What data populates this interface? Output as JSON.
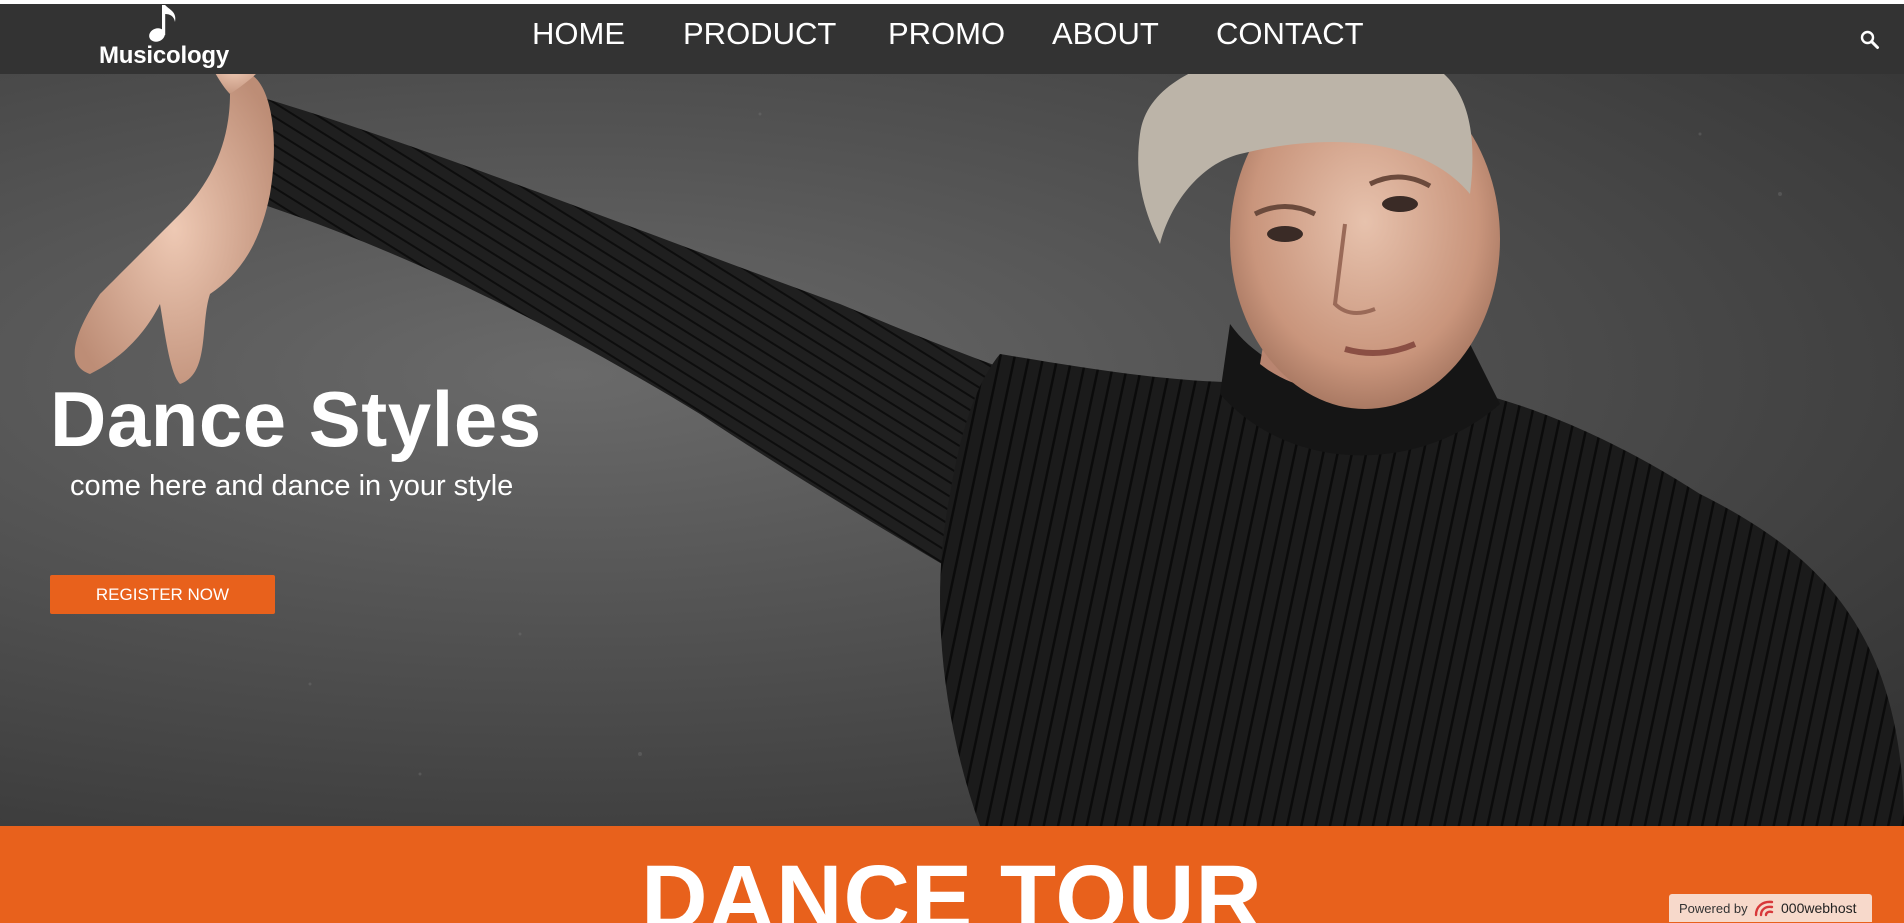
{
  "header": {
    "brand_name": "Musicology",
    "brand_icon": "music-note-icon",
    "nav": [
      {
        "label": "HOME"
      },
      {
        "label": "PRODUCT"
      },
      {
        "label": "PROMO"
      },
      {
        "label": "ABOUT"
      },
      {
        "label": "CONTACT"
      }
    ],
    "search_icon": "search-icon"
  },
  "hero": {
    "title": "Dance Styles",
    "subtitle": "come here and dance in your style",
    "cta_label": "REGISTER NOW"
  },
  "band": {
    "title": "DANCE TOUR"
  },
  "badge": {
    "label": "Powered by",
    "brand": "000webhost"
  },
  "colors": {
    "nav_bg": "#333333",
    "accent": "#e8611c",
    "text_light": "#ffffff"
  }
}
